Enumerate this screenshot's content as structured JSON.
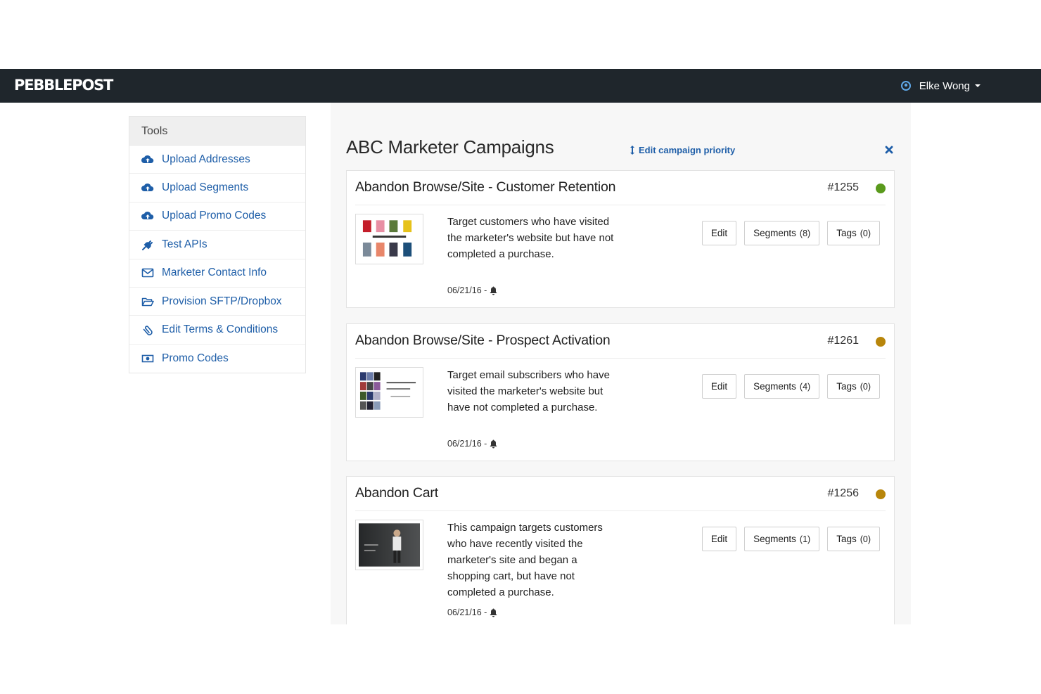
{
  "navbar": {
    "brand": "PEBBLEPOST",
    "user_name": "Elke Wong",
    "user_icon": "user-circle-icon"
  },
  "sidebar": {
    "header": "Tools",
    "items": [
      {
        "label": "Upload Addresses",
        "icon": "cloud-upload-icon"
      },
      {
        "label": "Upload Segments",
        "icon": "cloud-upload-icon"
      },
      {
        "label": "Upload Promo Codes",
        "icon": "cloud-upload-icon"
      },
      {
        "label": "Test APIs",
        "icon": "plug-icon"
      },
      {
        "label": "Marketer Contact Info",
        "icon": "envelope-icon"
      },
      {
        "label": "Provision SFTP/Dropbox",
        "icon": "folder-open-icon"
      },
      {
        "label": "Edit Terms & Conditions",
        "icon": "paperclip-icon"
      },
      {
        "label": "Promo Codes",
        "icon": "money-icon"
      }
    ]
  },
  "main": {
    "title": "ABC Marketer Campaigns",
    "edit_priority_label": "Edit campaign priority",
    "campaigns": [
      {
        "title": "Abandon Browse/Site - Customer Retention",
        "id": "#1255",
        "status_color": "#5a9a1c",
        "description": "Target customers who have visited the marketer's website but have not completed a purchase.",
        "date": "06/21/16 -",
        "edit_label": "Edit",
        "segments_label": "Segments",
        "segments_count": "(8)",
        "tags_label": "Tags",
        "tags_count": "(0)"
      },
      {
        "title": "Abandon Browse/Site - Prospect Activation",
        "id": "#1261",
        "status_color": "#b8860b",
        "description": "Target email subscribers who have visited the marketer's website but have not completed a purchase.",
        "date": "06/21/16 -",
        "edit_label": "Edit",
        "segments_label": "Segments",
        "segments_count": "(4)",
        "tags_label": "Tags",
        "tags_count": "(0)"
      },
      {
        "title": "Abandon Cart",
        "id": "#1256",
        "status_color": "#b8860b",
        "description": "This campaign targets customers who have recently visited the marketer's site and began a shopping cart, but have not completed a purchase.",
        "date": "06/21/16 -",
        "edit_label": "Edit",
        "segments_label": "Segments",
        "segments_count": "(1)",
        "tags_label": "Tags",
        "tags_count": "(0)"
      }
    ]
  },
  "colors": {
    "navbar_bg": "#1f262c",
    "link": "#1e5ea8",
    "panel_bg": "#f7f7f7"
  }
}
